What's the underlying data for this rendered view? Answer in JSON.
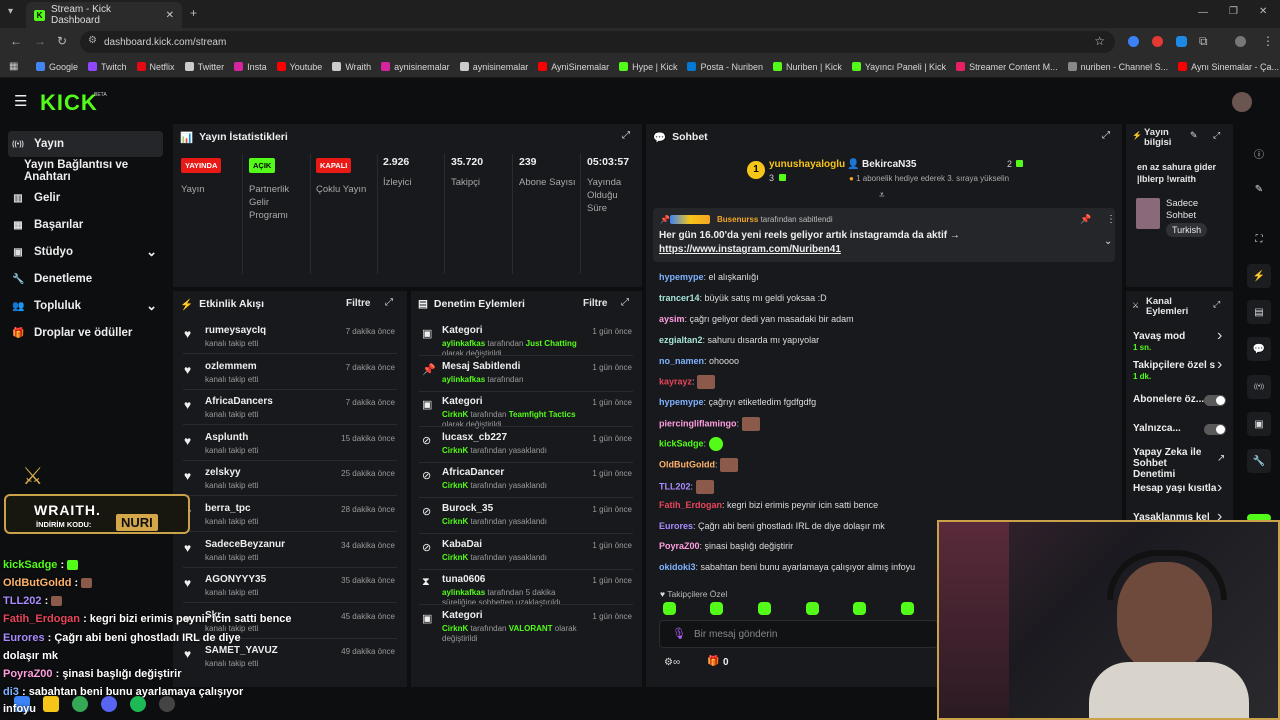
{
  "browser": {
    "tab_title": "Stream - Kick Dashboard",
    "url": "dashboard.kick.com/stream",
    "bookmarks": [
      {
        "label": "Google",
        "color": "#4285f4"
      },
      {
        "label": "Twitch",
        "color": "#9146ff"
      },
      {
        "label": "Netflix",
        "color": "#e50914"
      },
      {
        "label": "Twitter",
        "color": "#cccccc"
      },
      {
        "label": "Insta",
        "color": "#d6249f"
      },
      {
        "label": "Youtube",
        "color": "#ff0000"
      },
      {
        "label": "Wraith",
        "color": "#cccccc"
      },
      {
        "label": "aynisinemalar",
        "color": "#d6249f"
      },
      {
        "label": "aynisinemalar",
        "color": "#cccccc"
      },
      {
        "label": "AyniSinemalar",
        "color": "#ff0000"
      },
      {
        "label": "Hype | Kick",
        "color": "#53fc18"
      },
      {
        "label": "Posta - Nuriben",
        "color": "#0078d4"
      },
      {
        "label": "Nuriben | Kick",
        "color": "#53fc18"
      },
      {
        "label": "Yayıncı Paneli | Kick",
        "color": "#53fc18"
      },
      {
        "label": "Streamer Content M...",
        "color": "#e91e63"
      },
      {
        "label": "nuriben - Channel S...",
        "color": "#888888"
      },
      {
        "label": "Aynı Sinemalar - Ça...",
        "color": "#ff0000"
      }
    ]
  },
  "brand": {
    "logo": "KICK",
    "beta": "BETA"
  },
  "sidebar": {
    "items": [
      {
        "label": "Yayın",
        "icon": "broadcast-icon"
      },
      {
        "label": "Yayın Bağlantısı ve Anahtarı"
      },
      {
        "label": "Gelir",
        "icon": "revenue-icon"
      },
      {
        "label": "Başarılar",
        "icon": "achievements-icon"
      },
      {
        "label": "Stüdyo",
        "icon": "studio-icon"
      },
      {
        "label": "Denetleme",
        "icon": "wrench-icon"
      },
      {
        "label": "Topluluk",
        "icon": "community-icon"
      },
      {
        "label": "Droplar ve ödüller",
        "icon": "gift-icon"
      }
    ]
  },
  "stats": {
    "title": "Yayın İstatistikleri",
    "columns": [
      {
        "badge": "YAYINDA",
        "badge_color": "#e91916",
        "label": "Yayın"
      },
      {
        "badge": "AÇIK",
        "badge_color": "#53fc18",
        "label": "Partnerlik Gelir Programı"
      },
      {
        "badge": "KAPALI",
        "badge_color": "#e91916",
        "label": "Çoklu Yayın"
      },
      {
        "value": "2.926",
        "label": "İzleyici"
      },
      {
        "value": "35.720",
        "label": "Takipçi"
      },
      {
        "value": "239",
        "label": "Abone Sayısı"
      },
      {
        "value": "05:03:57",
        "label": "Yayında Olduğu Süre"
      }
    ]
  },
  "activity": {
    "title": "Etkinlik Akışı",
    "filter": "Filtre",
    "items": [
      {
        "name": "rumeysaycIq",
        "sub": "kanalı takip etti",
        "time": "7 dakika önce"
      },
      {
        "name": "ozlemmem",
        "sub": "kanalı takip etti",
        "time": "7 dakika önce"
      },
      {
        "name": "AfricaDancers",
        "sub": "kanalı takip etti",
        "time": "7 dakika önce"
      },
      {
        "name": "Asplunth",
        "sub": "kanalı takip etti",
        "time": "15 dakika önce"
      },
      {
        "name": "zelskyy",
        "sub": "kanalı takip etti",
        "time": "25 dakika önce"
      },
      {
        "name": "berra_tpc",
        "sub": "kanalı takip etti",
        "time": "28 dakika önce"
      },
      {
        "name": "SadeceBeyzanur",
        "sub": "kanalı takip etti",
        "time": "34 dakika önce"
      },
      {
        "name": "AGONYYY35",
        "sub": "kanalı takip etti",
        "time": "35 dakika önce"
      },
      {
        "name": "Skr...",
        "sub": "kanalı takip etti",
        "time": "45 dakika önce"
      },
      {
        "name": "SAMET_YAVUZ",
        "sub": "kanalı takip etti",
        "time": "49 dakika önce"
      }
    ]
  },
  "moderation": {
    "title": "Denetim Eylemleri",
    "filter": "Filtre",
    "items": [
      {
        "icon": "category-icon",
        "title": "Kategori",
        "actor": "aylinkafkas",
        "mid": " tarafından ",
        "target": "Just Chatting",
        "tail": " olarak değiştirildi",
        "time": "1 gün önce"
      },
      {
        "icon": "pin-icon",
        "title": "Mesaj Sabitlendi",
        "actor": "aylinkafkas",
        "mid": " tarafından",
        "target": "",
        "tail": "",
        "time": "1 gün önce"
      },
      {
        "icon": "category-icon",
        "title": "Kategori",
        "actor": "CirknK",
        "mid": " tarafından ",
        "target": "Teamfight Tactics",
        "tail": " olarak değiştirildi",
        "time": "1 gün önce"
      },
      {
        "icon": "ban-icon",
        "title": "lucasx_cb227",
        "actor": "CirknK",
        "mid": " tarafından yasaklandı",
        "target": "",
        "tail": "",
        "time": "1 gün önce"
      },
      {
        "icon": "ban-icon",
        "title": "AfricaDancer",
        "actor": "CirknK",
        "mid": " tarafından yasaklandı",
        "target": "",
        "tail": "",
        "time": "1 gün önce"
      },
      {
        "icon": "ban-icon",
        "title": "Burock_35",
        "actor": "CirknK",
        "mid": " tarafından yasaklandı",
        "target": "",
        "tail": "",
        "time": "1 gün önce"
      },
      {
        "icon": "ban-icon",
        "title": "KabaDai",
        "actor": "CirknK",
        "mid": " tarafından yasaklandı",
        "target": "",
        "tail": "",
        "time": "1 gün önce"
      },
      {
        "icon": "timeout-icon",
        "title": "tuna0606",
        "actor": "aylinkafkas",
        "mid": " tarafından 5 dakika süreliğine sohbetten uzaklaştırıldı",
        "target": "",
        "tail": "",
        "time": "1 gün önce"
      },
      {
        "icon": "category-icon",
        "title": "Kategori",
        "actor": "CirknK",
        "mid": " tarafından ",
        "target": "VALORANT",
        "tail": " olarak değiştirildi",
        "time": "1 gün önce"
      }
    ]
  },
  "chat": {
    "title": "Sohbet",
    "gifters": [
      {
        "name": "yunushayaloglu",
        "count": "3",
        "rank": "1"
      },
      {
        "name": "BekircaN35",
        "count": "2",
        "note": "1 abonelik hediye ederek 3. sıraya yükselin"
      }
    ],
    "pinned": {
      "by": "Busenurss",
      "by_suffix": " tarafından sabitlendi",
      "text": "Her gün 16.00'da yeni reels geliyor artık instagramda da aktif →",
      "link": "https://www.instagram.com/Nuriben41"
    },
    "messages": [
      {
        "user": "hypemype",
        "color": "#7fb3ff",
        "text": "el alışkanlığı"
      },
      {
        "user": "trancer14",
        "color": "#a6e3d8",
        "text": "büyük satış mı geldi yoksaa :D"
      },
      {
        "user": "aysim",
        "color": "#ff9ee0",
        "text": "çağrı geliyor dedi yan masadaki bir adam"
      },
      {
        "user": "ezgialtan2",
        "color": "#a6e3d8",
        "text": "sahuru dısarda mı yapıyolar"
      },
      {
        "user": "no_namen",
        "color": "#7fb3ff",
        "text": "ohoooo"
      },
      {
        "user": "kayrayz",
        "color": "#e8455a",
        "text": "",
        "emote": true
      },
      {
        "user": "hypemype",
        "color": "#7fb3ff",
        "text": "çağrıyı etiketledim fgdfgdfg"
      },
      {
        "user": "piercingliflamingo",
        "color": "#ff9ee0",
        "text": "",
        "emote": true
      },
      {
        "user": "kickSadge",
        "color": "#53fc18",
        "text": "",
        "emote": true
      },
      {
        "user": "OldButGoldd",
        "color": "#ffb36b",
        "text": "",
        "emote": true
      },
      {
        "user": "TLL202",
        "color": "#a98bff",
        "text": "",
        "emote": true
      },
      {
        "user": "Fatih_Erdogan",
        "color": "#e8455a",
        "text": "kegri bizi erimis peynir icin satti bence"
      },
      {
        "user": "Eurores",
        "color": "#a98bff",
        "text": "Çağrı abi beni ghostladı IRL de diye dolaşır mk"
      },
      {
        "user": "PoyraZ00",
        "color": "#ff9ee0",
        "text": "şinasi başlığı değiştirir"
      },
      {
        "user": "okidoki3",
        "color": "#7fb3ff",
        "text": "sabahtan beni bunu ayarlamaya çalışıyor almış infoyu"
      }
    ],
    "followers_only": "Takipçilere Özel",
    "input_placeholder": "Bir mesaj gönderin",
    "points": "0"
  },
  "stream_info": {
    "title": "Yayın bilgisi",
    "description": "en az sahura gider |Iblerp !wraith",
    "category": "Sadece Sohbet",
    "tag": "Turkish"
  },
  "channel_actions": {
    "title": "Kanal Eylemleri",
    "items": [
      {
        "label": "Yavaş mod",
        "sub": "1 sn.",
        "control": "chevron"
      },
      {
        "label": "Takipçilere özel s",
        "sub": "1 dk.",
        "control": "chevron"
      },
      {
        "label": "Abonelere öz...",
        "sub": "",
        "control": "toggle"
      },
      {
        "label": "Yalnızca...",
        "sub": "",
        "control": "toggle"
      },
      {
        "label": "Yapay Zeka ile Sohbet Denetimi",
        "sub": "",
        "control": "external"
      },
      {
        "label": "Hesap yaşı kısıtla",
        "sub": "",
        "control": "chevron"
      },
      {
        "label": "Yasaklanmış kelim",
        "sub": "",
        "control": "chevron"
      }
    ]
  },
  "overlay": {
    "banner_brand": "WRAITH.",
    "banner_code_label": "İNDİRİM KODU:",
    "banner_code": "NURI",
    "lines": [
      {
        "user": "kickSadge",
        "color": "#53fc18",
        "text": ""
      },
      {
        "user": "OldButGoldd",
        "color": "#ffb36b",
        "text": ""
      },
      {
        "user": "TLL202",
        "color": "#a98bff",
        "text": ""
      },
      {
        "user": "Fatih_Erdogan",
        "color": "#e8455a",
        "text": "kegri bizi erimis peynir icin satti bence"
      },
      {
        "user": "Eurores",
        "color": "#a98bff",
        "text": "Çağrı abi beni ghostladı IRL de diye"
      },
      {
        "user": "",
        "color": "#ffffff",
        "text": "dolaşır mk"
      },
      {
        "user": "PoyraZ00",
        "color": "#ff9ee0",
        "text": "şinasi başlığı değiştirir"
      },
      {
        "user": "di3",
        "color": "#7fb3ff",
        "text": "sabahtan beni bunu ayarlamaya çalışıyor"
      },
      {
        "user": "",
        "color": "#ffffff",
        "text": "infoyu"
      }
    ]
  }
}
